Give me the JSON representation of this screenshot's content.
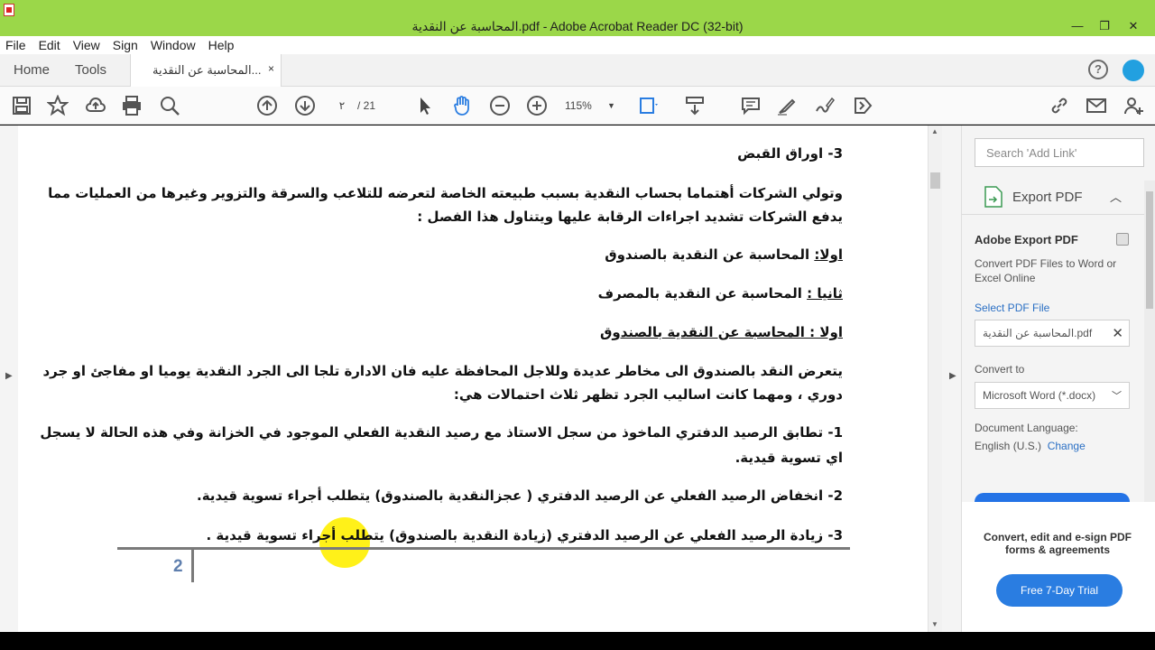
{
  "window": {
    "title": "المحاسبة عن النقدية.pdf - Adobe Acrobat Reader DC (32-bit)",
    "minimize": "—",
    "restore": "❐",
    "close": "✕"
  },
  "menu": [
    "File",
    "Edit",
    "View",
    "Sign",
    "Window",
    "Help"
  ],
  "tabs": {
    "home": "Home",
    "tools": "Tools",
    "document": "المحاسبة عن النقدية...",
    "close": "×"
  },
  "toolbar": {
    "page_current": "٢",
    "page_total": "/ 21",
    "zoom": "115%",
    "zoom_caret": "▼",
    "icons": [
      "save-icon",
      "bookmark-star-icon",
      "upload-cloud-icon",
      "print-icon",
      "search-zoom-icon",
      "previous-page-icon",
      "next-page-icon",
      "select-cursor-icon",
      "hand-tool-icon",
      "zoom-out-icon",
      "zoom-in-icon",
      "fit-page-icon",
      "scroll-mode-icon",
      "comment-icon",
      "highlight-pen-icon",
      "sign-icon",
      "more-tools-icon",
      "share-link-icon",
      "email-icon",
      "add-user-icon"
    ]
  },
  "document": {
    "heading": "3- اوراق القبض",
    "para1_line1": "وتولي الشركات أهتماما بحساب النقدية بسبب طبيعته الخاصة لتعرضه للتلاعب والسرقة والتزوير وغيرها من العمليات مما",
    "para1_line2": "يدفع الشركات تشديد اجراءات الرقابة عليها ويتناول هذا الفصل :",
    "item1_prefix": "اولا:",
    "item1_text": " المحاسبة عن النقدية بالصندوق",
    "item2_prefix": "ثانيا :",
    "item2_text": " المحاسبة عن النقدية بالمصرف",
    "section_title": "اولا : المحاسبة عن النقدية بالصندوق",
    "para2_line1": "يتعرض النقد بالصندوق الى مخاطر عديدة وللاجل المحافظة عليه فان الادارة تلجا الى الجرد النقدية يوميا او مفاجئ او جرد",
    "para2_line2": "دوري ، ومهما كانت اساليب الجرد تظهر ثلاث احتمالات هي:",
    "case1_line1": "1- تطابق الرصيد الدفتري الماخوذ من سجل الاستاذ مع رصيد النقدية الفعلي الموجود في الخزانة وفي هذه الحالة لا يسجل",
    "case1_line2": "اي تسوية قيدية.",
    "case2": "2- انخفاض الرصيد الفعلي عن الرصيد الدفتري ( عجزالنقدية بالصندوق) يتطلب أجراء تسوية قيدية.",
    "case3": "3- زيادة الرصيد الفعلي عن الرصيد الدفتري (زيادة النقدية بالصندوق) يتطلب أجراء تسوية قيدية .",
    "page_number": "2"
  },
  "right_panel": {
    "search_placeholder": "Search 'Add Link'",
    "export_label": "Export PDF",
    "title": "Adobe Export PDF",
    "description": "Convert PDF Files to Word or Excel Online",
    "select_file": "Select PDF File",
    "file_name": "المحاسبة عن النقدية.pdf",
    "convert_to_label": "Convert to",
    "convert_to_value": "Microsoft Word (*.docx)",
    "doc_language_label": "Document Language:",
    "doc_language_value": "English (U.S.)",
    "change": "Change",
    "promo": "Convert, edit and e-sign PDF forms & agreements",
    "trial_button": "Free 7-Day Trial"
  },
  "colors": {
    "titlebar": "#9bd749",
    "accent": "#2a7de1",
    "highlight": "#fff000"
  }
}
